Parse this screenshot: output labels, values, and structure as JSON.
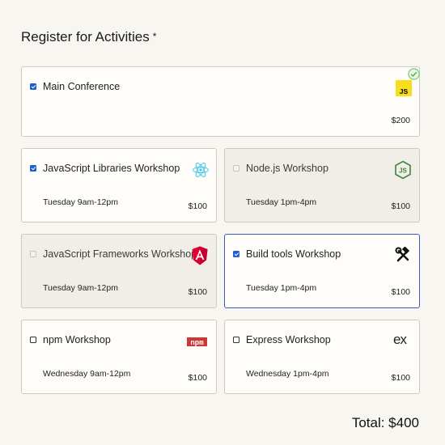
{
  "heading": "Register for Activities",
  "required_mark": "*",
  "activities": [
    {
      "id": "main",
      "title": "Main Conference",
      "time": "",
      "price": "$200",
      "checked": true,
      "disabled": false,
      "icon": "js-logo-icon"
    },
    {
      "id": "js-libs",
      "title": "JavaScript Libraries Workshop",
      "time": "Tuesday 9am-12pm",
      "price": "$100",
      "checked": true,
      "disabled": false,
      "icon": "react-logo-icon"
    },
    {
      "id": "node",
      "title": "Node.js Workshop",
      "time": "Tuesday 1pm-4pm",
      "price": "$100",
      "checked": false,
      "disabled": true,
      "icon": "nodejs-logo-icon"
    },
    {
      "id": "js-frameworks",
      "title": "JavaScript Frameworks Workshop",
      "time": "Tuesday 9am-12pm",
      "price": "$100",
      "checked": false,
      "disabled": true,
      "icon": "angular-logo-icon"
    },
    {
      "id": "build-tools",
      "title": "Build tools Workshop",
      "time": "Tuesday 1pm-4pm",
      "price": "$100",
      "checked": true,
      "disabled": false,
      "icon": "hammer-wrench-icon"
    },
    {
      "id": "npm",
      "title": "npm Workshop",
      "time": "Wednesday 9am-12pm",
      "price": "$100",
      "checked": false,
      "disabled": false,
      "icon": "npm-logo-icon"
    },
    {
      "id": "express",
      "title": "Express Workshop",
      "time": "Wednesday 1pm-4pm",
      "price": "$100",
      "checked": false,
      "disabled": false,
      "icon": "express-logo-icon"
    }
  ],
  "npm_icon_text": "npm",
  "express_icon_text": "ex",
  "js_icon_text": "JS",
  "total": "Total: $400",
  "colors": {
    "background": "#f8f6f1",
    "card": "#fefdf9",
    "card_disabled": "#f1eee8",
    "checkbox_checked": "#1d5fce",
    "focus_border": "#3b5bbd",
    "js_yellow": "#f7df1e",
    "react_cyan": "#4fc9ed",
    "node_green": "#3c873a",
    "angular_red": "#dd0031",
    "npm_red": "#cb3837",
    "valid_green": "#7dc96f"
  }
}
